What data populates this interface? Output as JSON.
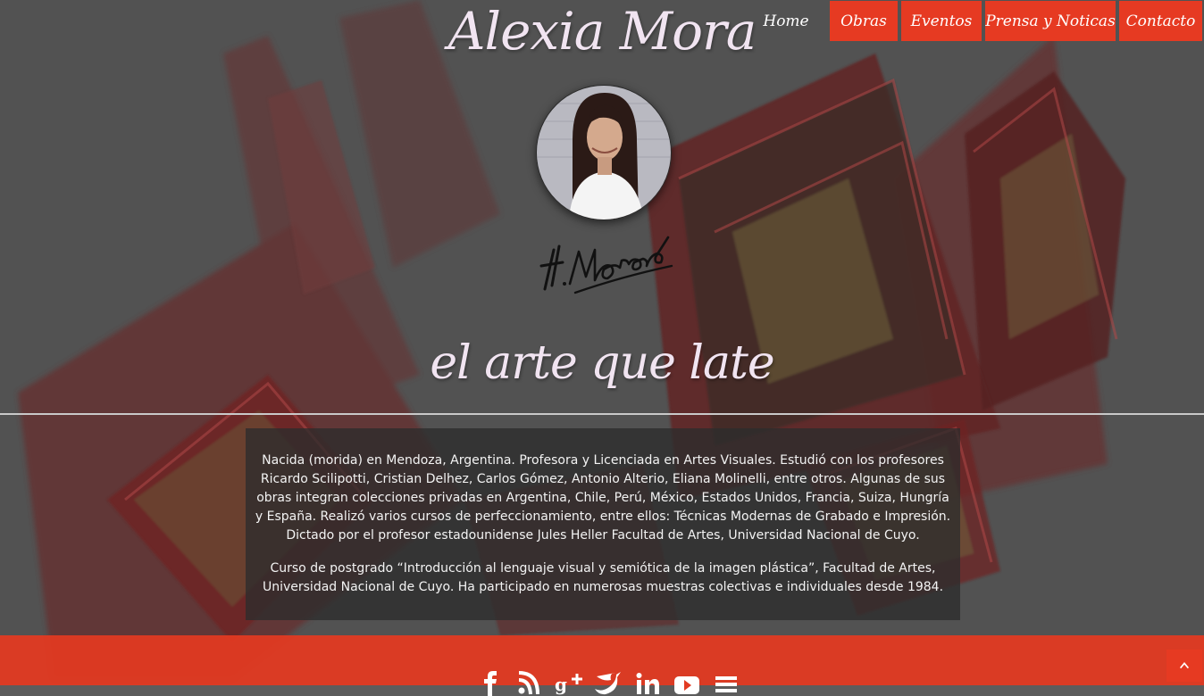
{
  "site": {
    "title": "Alexia Mora",
    "tagline": "el arte que late"
  },
  "nav": {
    "items": [
      {
        "label": "Home"
      },
      {
        "label": "Obras"
      },
      {
        "label": "Eventos"
      },
      {
        "label": "Prensa y Noticas"
      },
      {
        "label": "Contacto"
      }
    ],
    "active": "Home"
  },
  "signature_text": "H.Moreno",
  "bio": {
    "paragraphs": [
      "Nacida (morida) en Mendoza, Argentina. Profesora y Licenciada en Artes Visuales. Estudió con los profesores Ricardo Scilipotti, Cristian Delhez, Carlos Gómez, Antonio Alterio, Eliana Molinelli, entre otros. Algunas de sus obras integran colecciones privadas en Argentina, Chile, Perú, México, Estados Unidos, Francia, Suiza, Hungría y España. Realizó varios cursos de perfeccionamiento, entre ellos: Técnicas Modernas de Grabado e Impresión. Dictado por el profesor estadounidense Jules Heller Facultad de Artes, Universidad Nacional de Cuyo.",
      "Curso de postgrado “Introducción al lenguaje visual y semiótica de la imagen plástica”, Facultad de Artes, Universidad Nacional de Cuyo. Ha participado en numerosas muestras colectivas e individuales desde 1984."
    ]
  },
  "footer": {
    "social_icons": [
      "facebook-icon",
      "rss-icon",
      "google-plus-icon",
      "twitter-icon",
      "linkedin-icon",
      "youtube-icon",
      "stack-icon"
    ]
  },
  "back_to_top_icon": "chevron-up-icon",
  "colors": {
    "accent": "#e63a22",
    "title_text": "#f1e4f1",
    "background": "#5c5c5c"
  }
}
